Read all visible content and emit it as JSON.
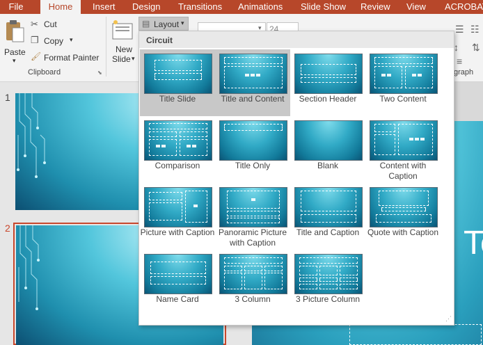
{
  "tabs": [
    "File",
    "Home",
    "Insert",
    "Design",
    "Transitions",
    "Animations",
    "Slide Show",
    "Review",
    "View",
    "ACROBAT"
  ],
  "active_tab": "Home",
  "clipboard": {
    "paste_label": "Paste",
    "cut_label": "Cut",
    "copy_label": "Copy",
    "format_painter_label": "Format Painter",
    "group_label": "Clipboard"
  },
  "slides_group": {
    "new_slide_line1": "New",
    "new_slide_line2": "Slide",
    "layout_label": "Layout"
  },
  "font": {
    "size_value": "24"
  },
  "paragraph_group_label_partial": "graph",
  "thumbnails": [
    {
      "number": "1"
    },
    {
      "number": "2"
    }
  ],
  "main_slide": {
    "title_partial": "Te"
  },
  "colors": {
    "ribbon_accent": "#b7472a",
    "selected_thumb_border": "#c8472c"
  },
  "layout_dropdown": {
    "theme_name": "Circuit",
    "layouts": [
      {
        "label": "Title Slide",
        "selected": true
      },
      {
        "label": "Title and Content",
        "selected": true
      },
      {
        "label": "Section Header",
        "selected": false
      },
      {
        "label": "Two Content",
        "selected": false
      },
      {
        "label": "Comparison",
        "selected": false
      },
      {
        "label": "Title Only",
        "selected": false
      },
      {
        "label": "Blank",
        "selected": false
      },
      {
        "label": "Content with Caption",
        "selected": false
      },
      {
        "label": "Picture with Caption",
        "selected": false
      },
      {
        "label": "Panoramic Picture with Caption",
        "selected": false
      },
      {
        "label": "Title and Caption",
        "selected": false
      },
      {
        "label": "Quote with Caption",
        "selected": false
      },
      {
        "label": "Name Card",
        "selected": false
      },
      {
        "label": "3 Column",
        "selected": false
      },
      {
        "label": "3 Picture Column",
        "selected": false
      }
    ]
  }
}
